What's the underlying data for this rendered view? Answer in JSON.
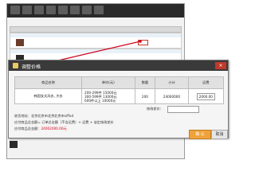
{
  "colors": {
    "dialog_title_bg": "#3a3a3a",
    "ok_button": "#f0a23a",
    "red_text": "#d0021b",
    "pointer_line": "#d0021b"
  },
  "dialog": {
    "title": "调整价格",
    "close_icon": "close-icon",
    "columns": [
      "商品名称",
      "单价(元)",
      "数量",
      "小计",
      "运费"
    ],
    "row": {
      "name": "韩国女式风衣, 大衣",
      "price_tiers": [
        "200-299件 15000元",
        "300-599件 13000元",
        "600件以上 10000元"
      ],
      "quantity": "200",
      "subtotal": "24000000",
      "shipping": "2000.00"
    },
    "discount_label": "修改差价：",
    "address_label": "收货地址：北京北京市",
    "address_value": "北京北京市siffxd",
    "formula_label": "应付商品总金额",
    "formula": "= 订单总金额（不含运费）+ 运费 + 该定修改差价",
    "total_label": "应付商品总金额：",
    "total_value": "24002000.00元",
    "ok_label": "确 认",
    "cancel_label": "取消"
  }
}
